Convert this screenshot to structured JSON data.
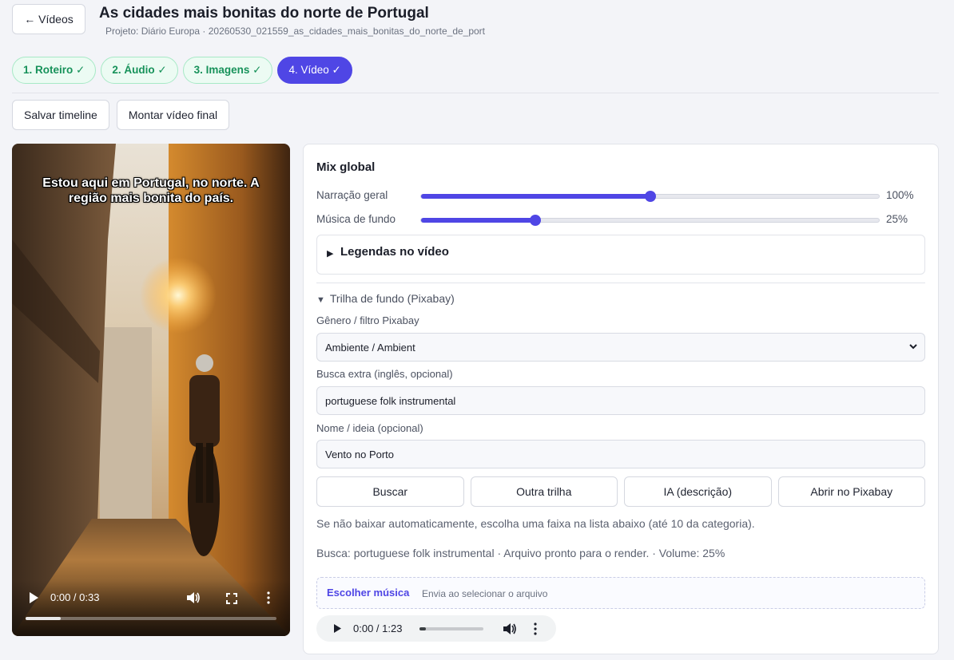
{
  "header": {
    "back_label": "← Vídeos",
    "title": "As cidades mais bonitas do norte de Portugal",
    "subtitle": "Projeto: Diário Europa · 20260530_021559_as_cidades_mais_bonitas_do_norte_de_port"
  },
  "steps": [
    {
      "label": "1. Roteiro ✓",
      "active": false
    },
    {
      "label": "2. Áudio ✓",
      "active": false
    },
    {
      "label": "3. Imagens ✓",
      "active": false
    },
    {
      "label": "4. Vídeo ✓",
      "active": true
    }
  ],
  "actions": {
    "save_label": "Salvar timeline",
    "render_label": "Montar vídeo final"
  },
  "video": {
    "caption": "Estou aqui em Portugal, no norte. A região mais bonita do país.",
    "time": "0:00 / 0:33",
    "progress": 0.14
  },
  "mix": {
    "title": "Mix global",
    "narration": {
      "label": "Narração geral",
      "value_text": "100%",
      "level": 0.5
    },
    "music": {
      "label": "Música de fundo",
      "value_text": "25%",
      "level": 0.25
    }
  },
  "captions": {
    "label": "Legendas no vídeo"
  },
  "track": {
    "title": "Trilha de fundo (Pixabay)",
    "genre_label": "Gênero / filtro Pixabay",
    "genre_value": "Ambiente / Ambient",
    "search_label": "Busca extra (inglês, opcional)",
    "search_value": "portuguese folk instrumental",
    "name_label": "Nome / ideia (opcional)",
    "name_value": "Vento no Porto",
    "buttons": {
      "search": "Buscar",
      "other": "Outra trilha",
      "ai": "IA (descrição)",
      "open": "Abrir no Pixabay"
    },
    "hint": "Se não baixar automaticamente, escolha uma faixa na lista abaixo (até 10 da categoria).",
    "status": "Busca: portuguese folk instrumental · Arquivo pronto para o render. · Volume: 25%",
    "file_button": "Escolher música",
    "file_note": "Envia ao selecionar o arquivo",
    "audio_time": "0:00 / 1:23",
    "audio_progress": 0.1
  },
  "colors": {
    "accent": "#4f46e5",
    "step_done": "#17925a"
  }
}
